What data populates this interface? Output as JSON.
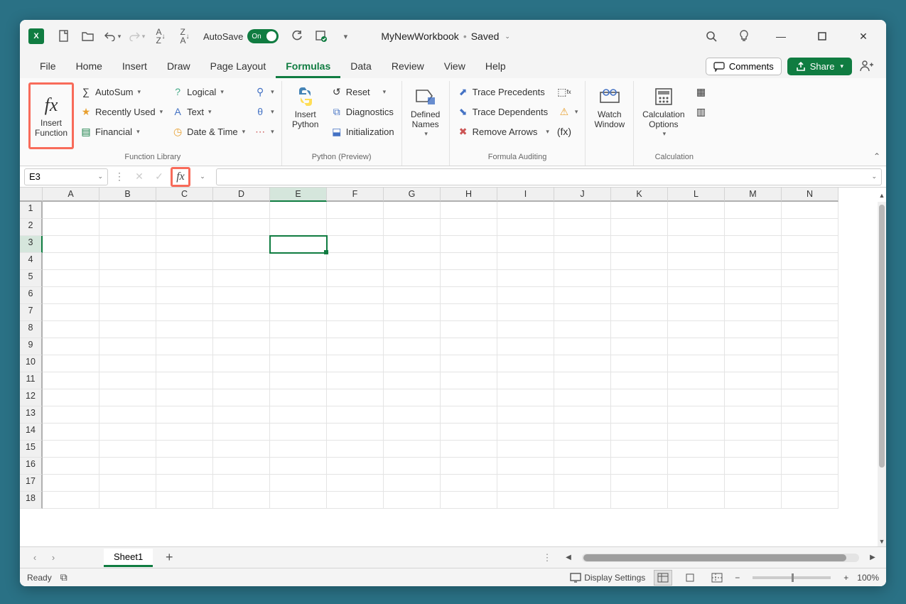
{
  "titlebar": {
    "autosave_label": "AutoSave",
    "autosave_state": "On",
    "workbook_name": "MyNewWorkbook",
    "save_state_sep": "•",
    "save_state": "Saved"
  },
  "tabs": {
    "file": "File",
    "home": "Home",
    "insert": "Insert",
    "draw": "Draw",
    "page_layout": "Page Layout",
    "formulas": "Formulas",
    "data": "Data",
    "review": "Review",
    "view": "View",
    "help": "Help",
    "comments": "Comments",
    "share": "Share"
  },
  "ribbon": {
    "insert_function": "Insert\nFunction",
    "autosum": "AutoSum",
    "recently_used": "Recently Used",
    "financial": "Financial",
    "logical": "Logical",
    "text": "Text",
    "date_time": "Date & Time",
    "group_function_library": "Function Library",
    "insert_python": "Insert\nPython",
    "reset": "Reset",
    "diagnostics": "Diagnostics",
    "initialization": "Initialization",
    "group_python": "Python (Preview)",
    "defined_names": "Defined\nNames",
    "trace_precedents": "Trace Precedents",
    "trace_dependents": "Trace Dependents",
    "remove_arrows": "Remove Arrows",
    "group_auditing": "Formula Auditing",
    "watch_window": "Watch\nWindow",
    "calculation_options": "Calculation\nOptions",
    "group_calculation": "Calculation"
  },
  "formula_bar": {
    "cell_ref": "E3"
  },
  "grid": {
    "columns": [
      "A",
      "B",
      "C",
      "D",
      "E",
      "F",
      "G",
      "H",
      "I",
      "J",
      "K",
      "L",
      "M",
      "N"
    ],
    "rows": [
      1,
      2,
      3,
      4,
      5,
      6,
      7,
      8,
      9,
      10,
      11,
      12,
      13,
      14,
      15,
      16,
      17,
      18
    ],
    "selected_col": "E",
    "selected_row": 3
  },
  "sheets": {
    "active": "Sheet1"
  },
  "status": {
    "ready": "Ready",
    "display_settings": "Display Settings",
    "zoom": "100%"
  }
}
